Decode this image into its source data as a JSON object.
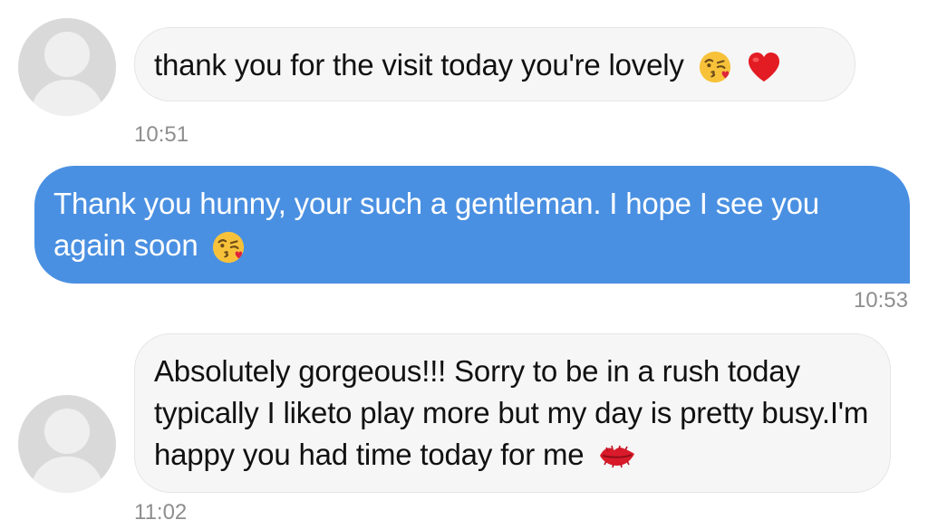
{
  "messages": [
    {
      "sender": "received",
      "text": "thank you for the visit today you're lovely",
      "emojis": [
        "kissing-face-icon",
        "red-heart-icon"
      ],
      "time": "10:51"
    },
    {
      "sender": "sent",
      "text": "Thank you hunny, your such a gentleman. I hope I see you again soon",
      "emojis": [
        "kissing-face-icon"
      ],
      "time": "10:53"
    },
    {
      "sender": "received",
      "text": "Absolutely gorgeous!!! Sorry to be in a rush today typically I liketo play more but my day is pretty busy.I'm happy you had time today for me",
      "emojis": [
        "kiss-lips-icon"
      ],
      "time": "11:02"
    }
  ],
  "colors": {
    "sent_bubble": "#4a90e2",
    "received_bubble": "#f6f6f6",
    "timestamp": "#8e8e8e",
    "avatar": "#d9d9d9"
  }
}
